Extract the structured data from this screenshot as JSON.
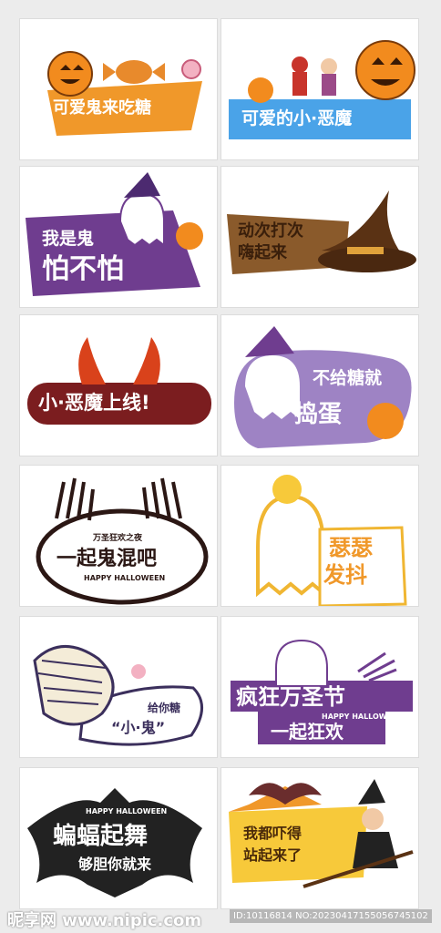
{
  "colors": {
    "background": "#ececec",
    "orange": "#f0982a",
    "blue": "#4aa3e8",
    "purple": "#6f3d8f",
    "brown": "#8a5a2b",
    "dark_red": "#7b1d1f",
    "lavender": "#9e83c4",
    "black": "#222222",
    "yellow": "#f7c93a"
  },
  "stickers": [
    {
      "lines": [
        "可爱鬼来吃糖"
      ]
    },
    {
      "lines": [
        "可爱的小·恶魔"
      ]
    },
    {
      "lines": [
        "我是鬼",
        "怕不怕"
      ]
    },
    {
      "lines": [
        "动次打次",
        "嗨起来"
      ]
    },
    {
      "lines": [
        "小·恶魔上线!"
      ]
    },
    {
      "lines": [
        "不给糖就",
        "捣蛋"
      ]
    },
    {
      "lines": [
        "万圣狂欢之夜",
        "一起鬼混吧",
        "HAPPY HALLOWEEN"
      ]
    },
    {
      "lines": [
        "瑟瑟",
        "发抖"
      ]
    },
    {
      "lines": [
        "给你糖",
        "“小·鬼”"
      ]
    },
    {
      "lines": [
        "疯狂万圣节",
        "HAPPY HALLOWEEN",
        "一起狂欢"
      ]
    },
    {
      "lines": [
        "HAPPY HALLOWEEN",
        "蝙蝠起舞",
        "够胆你就来"
      ]
    },
    {
      "lines": [
        "我都吓得",
        "站起来了"
      ]
    }
  ],
  "watermark": {
    "left": "昵享网 www.nipic.com",
    "right": "ID:10116814 NO:20230417155056745102"
  }
}
